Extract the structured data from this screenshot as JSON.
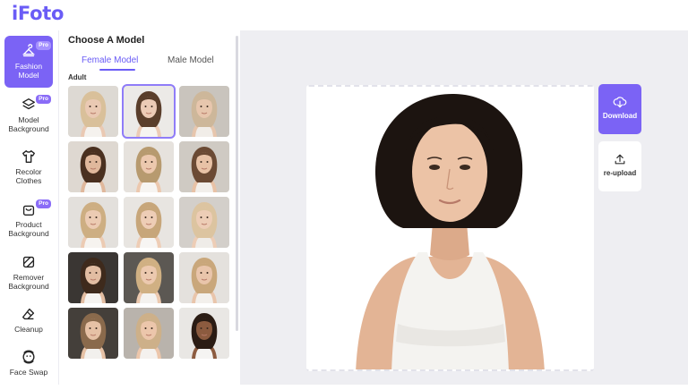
{
  "app": {
    "logo": "iFoto"
  },
  "sidebar": {
    "items": [
      {
        "label_line1": "Fashion",
        "label_line2": "Model",
        "icon": "hanger-icon",
        "pro": "Pro",
        "active": true
      },
      {
        "label_line1": "Model",
        "label_line2": "Background",
        "icon": "layers-icon",
        "pro": "Pro",
        "active": false
      },
      {
        "label_line1": "Recolor",
        "label_line2": "Clothes",
        "icon": "tshirt-icon",
        "pro": "",
        "active": false
      },
      {
        "label_line1": "Product",
        "label_line2": "Background",
        "icon": "bag-icon",
        "pro": "Pro",
        "active": false
      },
      {
        "label_line1": "Remover",
        "label_line2": "Background",
        "icon": "remove-bg-icon",
        "pro": "",
        "active": false
      },
      {
        "label_line1": "Cleanup",
        "label_line2": "",
        "icon": "eraser-icon",
        "pro": "",
        "active": false
      },
      {
        "label_line1": "Face Swap",
        "label_line2": "",
        "icon": "face-swap-icon",
        "pro": "",
        "active": false
      }
    ]
  },
  "panel": {
    "title": "Choose A Model",
    "tabs": [
      {
        "label": "Female Model",
        "active": true
      },
      {
        "label": "Male Model",
        "active": false
      }
    ],
    "section": "Adult",
    "models": [
      {
        "hair": "#d9c09a",
        "skin": "#eac9b3",
        "top": "#f5f2ee",
        "bg": "#ddd9d3"
      },
      {
        "hair": "#5a3e2b",
        "skin": "#eccbb6",
        "top": "#f6f4f1",
        "bg": "#eceae7",
        "selected": true
      },
      {
        "hair": "#cdb79a",
        "skin": "#e7c6ad",
        "top": "#f1ede8",
        "bg": "#c9c4bd"
      },
      {
        "hair": "#4a3020",
        "skin": "#e0b89c",
        "top": "#f3f1ee",
        "bg": "#ded8d1"
      },
      {
        "hair": "#b79a6f",
        "skin": "#ecc8ae",
        "top": "#f7f5f2",
        "bg": "#e6e2dd"
      },
      {
        "hair": "#6b4a34",
        "skin": "#e8c2a6",
        "top": "#f2efeb",
        "bg": "#cfcac3"
      },
      {
        "hair": "#cdae82",
        "skin": "#eccbb3",
        "top": "#f6f3ef",
        "bg": "#e3e0dc"
      },
      {
        "hair": "#c7a67a",
        "skin": "#eecdb6",
        "top": "#f7f5f3",
        "bg": "#e8e5e1"
      },
      {
        "hair": "#dcc4a0",
        "skin": "#edcdb6",
        "top": "#efece8",
        "bg": "#d3cfca"
      },
      {
        "hair": "#3e2a1c",
        "skin": "#e2bda2",
        "top": "#f5f3f0",
        "bg": "#3a3633"
      },
      {
        "hair": "#d0b083",
        "skin": "#ecc9af",
        "top": "#f4f2ef",
        "bg": "#5c5853"
      },
      {
        "hair": "#c9a77b",
        "skin": "#e9c5ab",
        "top": "#f3f0ec",
        "bg": "#e4e1dd"
      },
      {
        "hair": "#8a6a4c",
        "skin": "#e6c1a5",
        "top": "#f2f0ed",
        "bg": "#443f3a"
      },
      {
        "hair": "#cdb089",
        "skin": "#ecc6ab",
        "top": "#f4f1ee",
        "bg": "#b9b3ac"
      },
      {
        "hair": "#2b1c14",
        "skin": "#8c5b3f",
        "top": "#f5f4f2",
        "bg": "#e9e7e4"
      }
    ]
  },
  "actions": {
    "download": "Download",
    "reupload": "re-upload"
  },
  "colors": {
    "accent": "#7b63f5",
    "canvas_bg": "#eeeef2"
  }
}
